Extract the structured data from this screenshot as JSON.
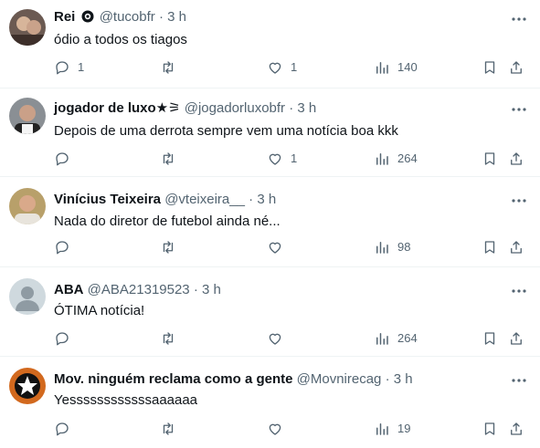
{
  "tweets": [
    {
      "name": "Rei",
      "handle": "@tucobfr",
      "dot": "·",
      "time": "3 h",
      "text": "ódio a todos os tiagos",
      "replies": "1",
      "retweets": "",
      "likes": "1",
      "views": "140"
    },
    {
      "name": "jogador de luxo★⚞",
      "handle": "@jogadorluxobfr",
      "dot": "·",
      "time": "3 h",
      "text": "Depois de uma derrota sempre vem uma notícia boa kkk",
      "replies": "",
      "retweets": "",
      "likes": "1",
      "views": "264"
    },
    {
      "name": "Vinícius Teixeira",
      "handle": "@vteixeira__",
      "dot": "·",
      "time": "3 h",
      "text": "Nada do diretor de futebol ainda né...",
      "replies": "",
      "retweets": "",
      "likes": "",
      "views": "98"
    },
    {
      "name": "ABA",
      "handle": "@ABA21319523",
      "dot": "·",
      "time": "3 h",
      "text": "ÓTIMA notícia!",
      "replies": "",
      "retweets": "",
      "likes": "",
      "views": "264"
    },
    {
      "name": "Mov. ninguém reclama como a gente",
      "handle": "@Movnirecag",
      "dot": "·",
      "time": "3 h",
      "text": "Yessssssssssssaaaaaa",
      "replies": "",
      "retweets": "",
      "likes": "",
      "views": "19"
    }
  ],
  "icons": {
    "more": "more-options-icon",
    "reply": "reply-icon",
    "retweet": "retweet-icon",
    "like": "like-icon",
    "views": "views-icon",
    "bookmark": "bookmark-icon",
    "share": "share-icon",
    "badge": "verified-badge-icon"
  },
  "colors": {
    "text": "#0f1419",
    "muted": "#536471",
    "divider": "#eff3f4"
  }
}
